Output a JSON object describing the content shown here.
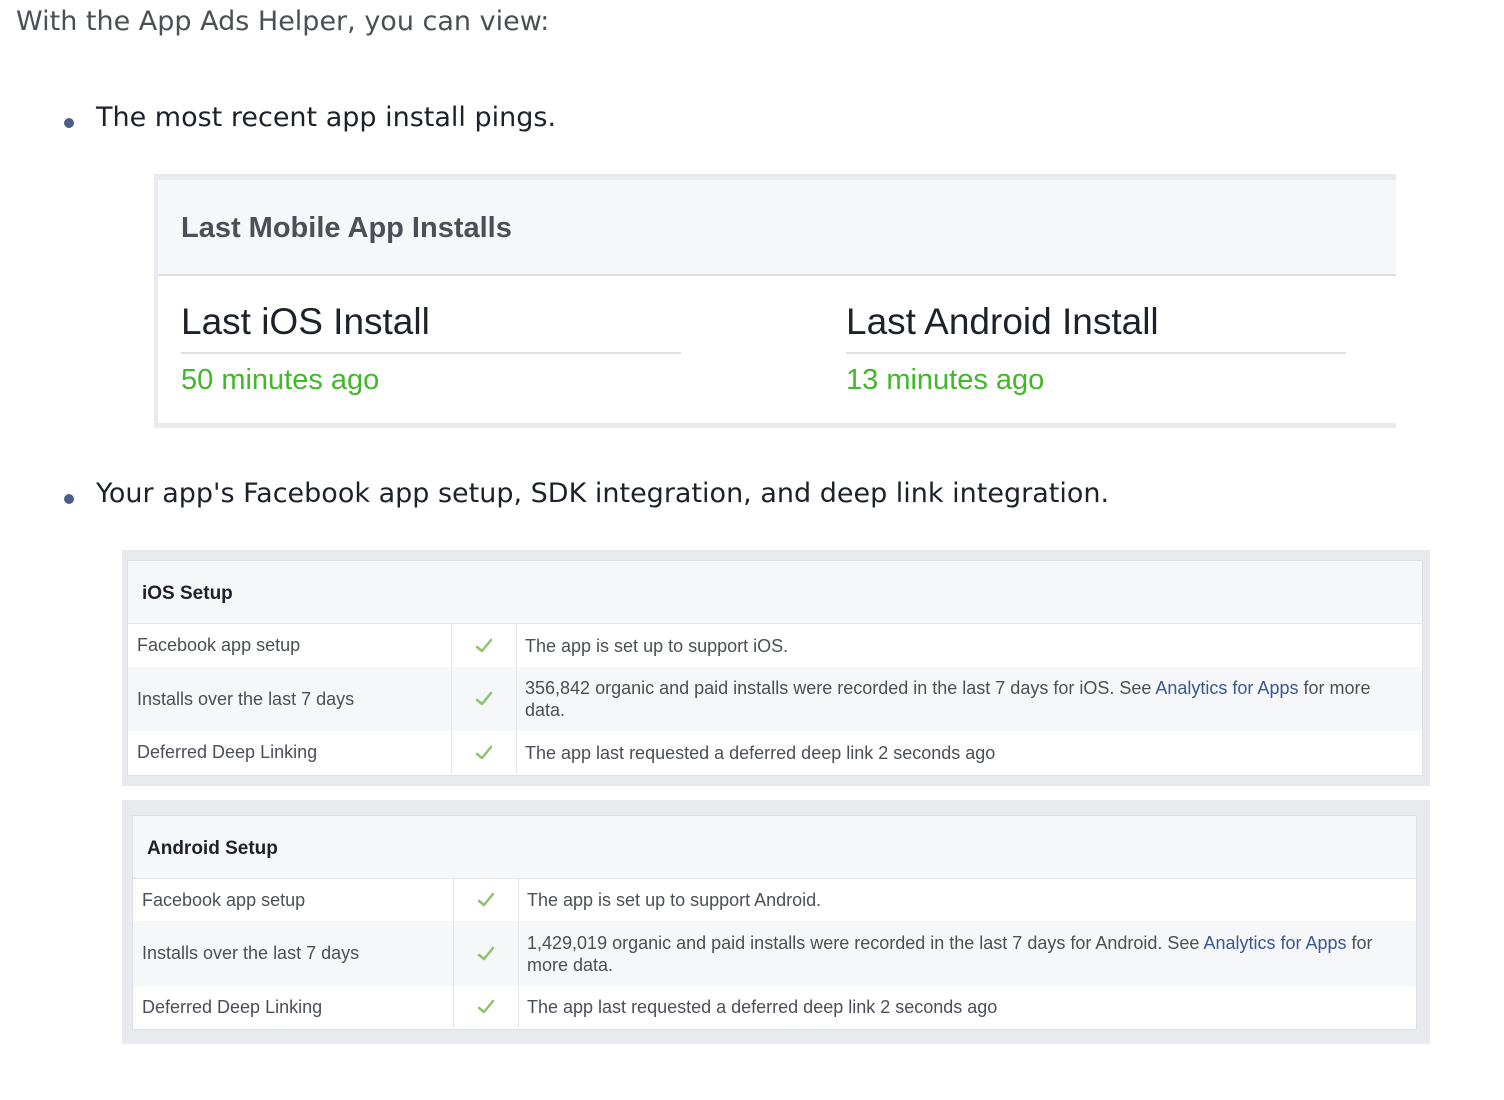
{
  "intro": "With the App Ads Helper, you can view:",
  "bullets": [
    "The most recent app install pings.",
    "Your app's Facebook app setup, SDK integration, and deep link integration."
  ],
  "installs": {
    "title": "Last Mobile App Installs",
    "ios_label": "Last iOS Install",
    "ios_value": "50 minutes ago",
    "android_label": "Last Android Install",
    "android_value": "13 minutes ago"
  },
  "ios_setup": {
    "title": "iOS Setup",
    "rows": [
      {
        "label": "Facebook app setup",
        "desc_pre": "The app is set up to support iOS.",
        "link": "",
        "desc_post": ""
      },
      {
        "label": "Installs over the last 7 days",
        "desc_pre": "356,842 organic and paid installs were recorded in the last 7 days for iOS. See ",
        "link": "Analytics for Apps",
        "desc_post": " for more data."
      },
      {
        "label": "Deferred Deep Linking",
        "desc_pre": "The app last requested a deferred deep link 2 seconds ago",
        "link": "",
        "desc_post": ""
      }
    ]
  },
  "android_setup": {
    "title": "Android Setup",
    "rows": [
      {
        "label": "Facebook app setup",
        "desc_pre": "The app is set up to support Android.",
        "link": "",
        "desc_post": ""
      },
      {
        "label": "Installs over the last 7 days",
        "desc_pre": "1,429,019 organic and paid installs were recorded in the last 7 days for Android. See ",
        "link": "Analytics for Apps",
        "desc_post": " for more data."
      },
      {
        "label": "Deferred Deep Linking",
        "desc_pre": "The app last requested a deferred deep link 2 seconds ago",
        "link": "",
        "desc_post": ""
      }
    ]
  },
  "colors": {
    "success": "#42b72a",
    "link": "#365899",
    "check": "#8dc26f"
  },
  "icons": {
    "status": "check-icon"
  }
}
